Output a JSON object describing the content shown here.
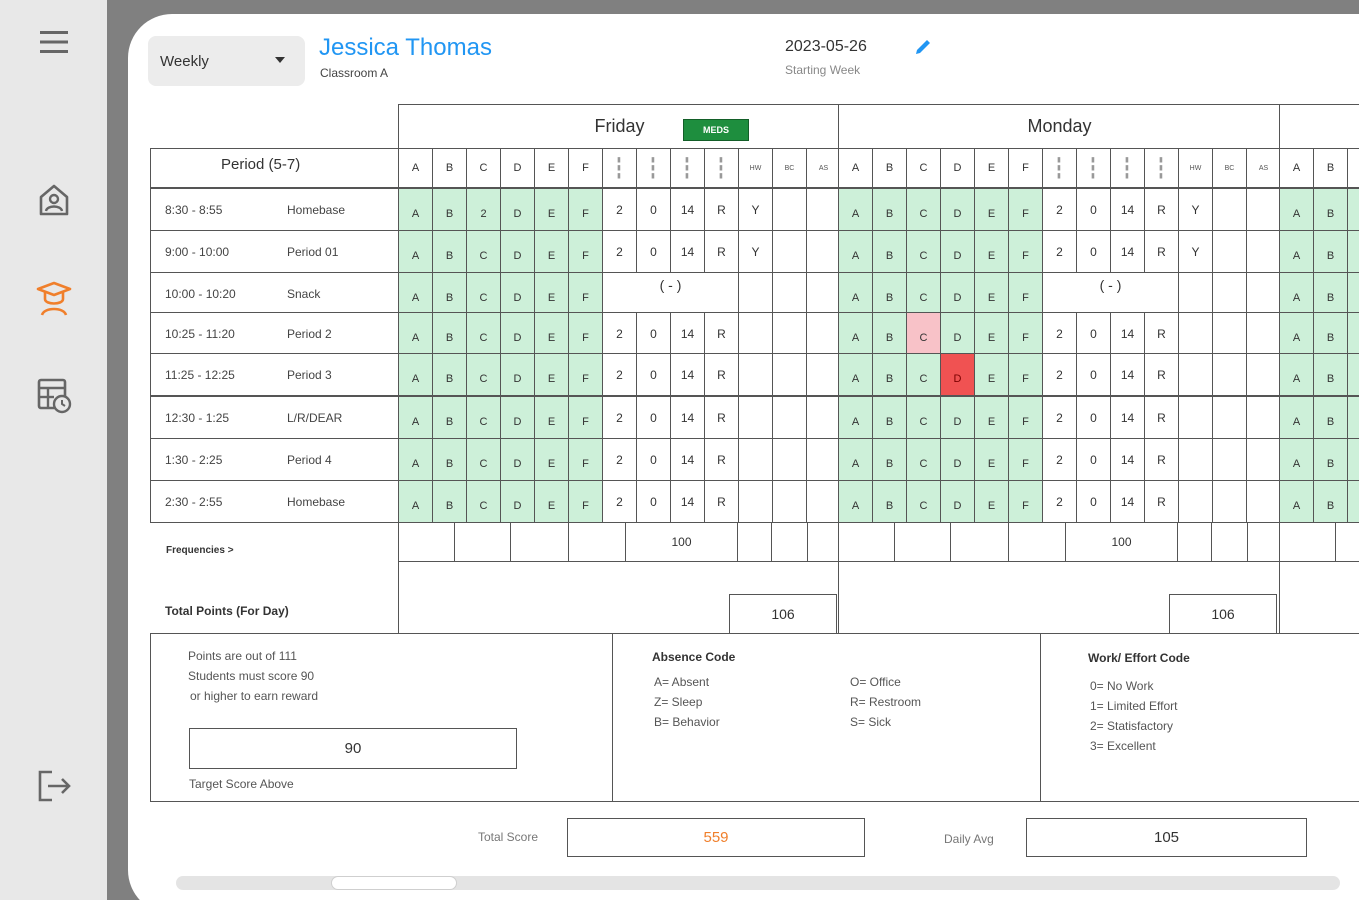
{
  "header": {
    "view_mode": "Weekly",
    "student_name": "Jessica Thomas",
    "classroom": "Classroom A",
    "week_date": "2023-05-26",
    "week_label": "Starting Week"
  },
  "sidebar": {
    "icons": [
      "menu-icon",
      "home-icon",
      "student-icon",
      "schedule-icon",
      "logout-icon"
    ],
    "active": "student-icon",
    "active_color": "#f07f2b"
  },
  "grid": {
    "period_header": "Period (5-7)",
    "column_headers": [
      "A",
      "B",
      "C",
      "D",
      "E",
      "F",
      "",
      "",
      "",
      "",
      "HW",
      "BC",
      "AS"
    ],
    "rows": [
      {
        "time": "8:30 -  8:55",
        "period": "Homebase"
      },
      {
        "time": "9:00 -  10:00",
        "period": "Period 01"
      },
      {
        "time": "10:00 -  10:20",
        "period": "Snack"
      },
      {
        "time": "10:25 -  11:20",
        "period": "Period 2"
      },
      {
        "time": "11:25 -  12:25",
        "period": "Period 3"
      },
      {
        "time": "12:30 -  1:25",
        "period": "L/R/DEAR"
      },
      {
        "time": "1:30 -  2:25",
        "period": "Period 4"
      },
      {
        "time": "2:30 -  2:55",
        "period": "Homebase"
      }
    ],
    "frequencies_label": "Frequencies >",
    "total_points_label": "Total Points (For Day)",
    "days": [
      {
        "name": "Friday",
        "badge": "MEDS",
        "letters": [
          [
            "A",
            "B",
            "2",
            "D",
            "E",
            "F"
          ],
          [
            "A",
            "B",
            "C",
            "D",
            "E",
            "F"
          ],
          [
            "A",
            "B",
            "C",
            "D",
            "E",
            "F"
          ],
          [
            "A",
            "B",
            "C",
            "D",
            "E",
            "F"
          ],
          [
            "A",
            "B",
            "C",
            "D",
            "E",
            "F"
          ],
          [
            "A",
            "B",
            "C",
            "D",
            "E",
            "F"
          ],
          [
            "A",
            "B",
            "C",
            "D",
            "E",
            "F"
          ],
          [
            "A",
            "B",
            "C",
            "D",
            "E",
            "F"
          ]
        ],
        "highlights": [],
        "values": [
          [
            "2",
            "0",
            "14",
            "R",
            "Y"
          ],
          [
            "2",
            "0",
            "14",
            "R",
            "Y"
          ],
          null,
          [
            "2",
            "0",
            "14",
            "R",
            ""
          ],
          [
            "2",
            "0",
            "14",
            "R",
            ""
          ],
          [
            "2",
            "0",
            "14",
            "R",
            ""
          ],
          [
            "2",
            "0",
            "14",
            "R",
            ""
          ],
          [
            "2",
            "0",
            "14",
            "R",
            ""
          ]
        ],
        "snack_text": "(   -   )",
        "frequency": "100",
        "total_points": "106"
      },
      {
        "name": "Monday",
        "badge": "",
        "letters": [
          [
            "A",
            "B",
            "C",
            "D",
            "E",
            "F"
          ],
          [
            "A",
            "B",
            "C",
            "D",
            "E",
            "F"
          ],
          [
            "A",
            "B",
            "C",
            "D",
            "E",
            "F"
          ],
          [
            "A",
            "B",
            "C",
            "D",
            "E",
            "F"
          ],
          [
            "A",
            "B",
            "C",
            "D",
            "E",
            "F"
          ],
          [
            "A",
            "B",
            "C",
            "D",
            "E",
            "F"
          ],
          [
            "A",
            "B",
            "C",
            "D",
            "E",
            "F"
          ],
          [
            "A",
            "B",
            "C",
            "D",
            "E",
            "F"
          ]
        ],
        "highlights": [
          {
            "row": 3,
            "col": 2,
            "level": "pink"
          },
          {
            "row": 4,
            "col": 3,
            "level": "red"
          }
        ],
        "values": [
          [
            "2",
            "0",
            "14",
            "R",
            "Y"
          ],
          [
            "2",
            "0",
            "14",
            "R",
            "Y"
          ],
          null,
          [
            "2",
            "0",
            "14",
            "R",
            ""
          ],
          [
            "2",
            "0",
            "14",
            "R",
            ""
          ],
          [
            "2",
            "0",
            "14",
            "R",
            ""
          ],
          [
            "2",
            "0",
            "14",
            "R",
            ""
          ],
          [
            "2",
            "0",
            "14",
            "R",
            ""
          ]
        ],
        "snack_text": "(   -   )",
        "frequency": "100",
        "total_points": "106"
      },
      {
        "name": "",
        "badge": "",
        "letters": [
          [
            "A",
            "B"
          ],
          [
            "A",
            "B"
          ],
          [
            "A",
            "B"
          ],
          [
            "A",
            "B"
          ],
          [
            "A",
            "B"
          ],
          [
            "A",
            "B"
          ],
          [
            "A",
            "B"
          ],
          [
            "A",
            "B"
          ]
        ],
        "highlights": [],
        "values": [],
        "snack_text": "",
        "frequency": "",
        "total_points": ""
      }
    ]
  },
  "points_info": {
    "lines": [
      "Points are out of 111",
      "Students must score 90",
      "or higher to earn reward"
    ],
    "target_score": "90",
    "target_label": "Target Score Above"
  },
  "absence_code": {
    "title": "Absence Code",
    "left": [
      "A= Absent",
      "Z= Sleep",
      "B= Behavior"
    ],
    "right": [
      "O= Office",
      "R= Restroom",
      "S= Sick"
    ]
  },
  "effort_code": {
    "title": "Work/ Effort Code",
    "items": [
      "0= No Work",
      "1= Limited Effort",
      "2= Statisfactory",
      "3= Excellent"
    ]
  },
  "summary": {
    "total_score_label": "Total Score",
    "total_score": "559",
    "total_score_color": "#f07f2b",
    "daily_avg_label": "Daily Avg",
    "daily_avg": "105"
  }
}
